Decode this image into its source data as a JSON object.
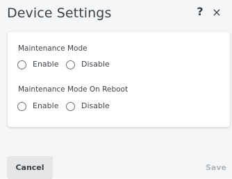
{
  "dialog": {
    "title": "Device Settings",
    "help_label": "?",
    "close_label": "×"
  },
  "settings": {
    "maintenance_mode": {
      "label": "Maintenance Mode",
      "options": [
        "Enable",
        "Disable"
      ],
      "selected": null
    },
    "maintenance_mode_on_reboot": {
      "label": "Maintenance Mode On Reboot",
      "options": [
        "Enable",
        "Disable"
      ],
      "selected": null
    }
  },
  "footer": {
    "cancel_label": "Cancel",
    "save_label": "Save"
  }
}
